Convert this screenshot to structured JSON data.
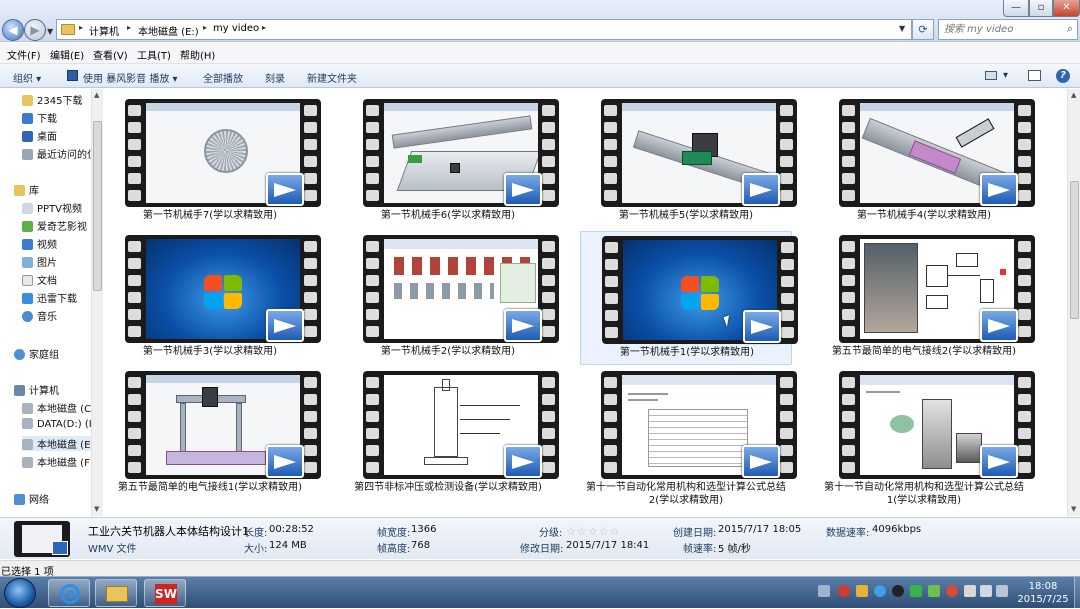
{
  "window": {
    "min": "—",
    "max": "▫",
    "close": "✕"
  },
  "address": {
    "crumbs": [
      "计算机",
      "本地磁盘 (E:)",
      "my video"
    ],
    "search_placeholder": "搜索 my video"
  },
  "menu": [
    "文件(F)",
    "编辑(E)",
    "查看(V)",
    "工具(T)",
    "帮助(H)"
  ],
  "toolbar": {
    "organize": "组织",
    "play_with": "使用 暴风影音 播放",
    "play_all": "全部播放",
    "burn": "刻录",
    "new_folder": "新建文件夹"
  },
  "nav": {
    "favorites": [
      "2345下载",
      "下载",
      "桌面",
      "最近访问的位"
    ],
    "library_title": "库",
    "libraries": [
      "PPTV视频",
      "爱奇艺影视",
      "视频",
      "图片",
      "文档",
      "迅雷下载",
      "音乐"
    ],
    "homegroup": "家庭组",
    "computer_title": "计算机",
    "drives": [
      "本地磁盘 (C",
      "DATA(D:) (I",
      "本地磁盘 (E",
      "本地磁盘 (F"
    ],
    "network": "网络"
  },
  "files": [
    {
      "name": "第一节机械手7(学以求精致用)",
      "thumb": "gear"
    },
    {
      "name": "第一节机械手6(学以求精致用)",
      "thumb": "rail"
    },
    {
      "name": "第一节机械手5(学以求精致用)",
      "thumb": "motor"
    },
    {
      "name": "第一节机械手4(学以求精致用)",
      "thumb": "plate"
    },
    {
      "name": "第一节机械手3(学以求精致用)",
      "thumb": "win7"
    },
    {
      "name": "第一节机械手2(学以求精致用)",
      "thumb": "icons"
    },
    {
      "name": "第一节机械手1(学以求精致用)",
      "thumb": "win7",
      "selected": true
    },
    {
      "name": "第五节最简单的电气接线2(学以求精致用)",
      "thumb": "circuit"
    },
    {
      "name": "第五节最简单的电气接线1(学以求精致用)",
      "thumb": "press"
    },
    {
      "name": "第四节非标冲压或检测设备(学以求精致用)",
      "thumb": "drawing"
    },
    {
      "name": "第十一节自动化常用机构和选型计算公式总结2(学以求精致用)",
      "thumb": "table"
    },
    {
      "name": "第十一节自动化常用机构和选型计算公式总结1(学以求精致用)",
      "thumb": "docphoto"
    }
  ],
  "details": {
    "filename": "工业六关节机器人本体结构设计1",
    "filetype": "WMV 文件",
    "length_label": "长度:",
    "length": "00:28:52",
    "size_label": "大小:",
    "size": "124 MB",
    "width_label": "帧宽度:",
    "width": "1366",
    "height_label": "帧高度:",
    "height": "768",
    "rating_label": "分级:",
    "rating": "☆☆☆☆☆",
    "modified_label": "修改日期:",
    "modified": "2015/7/17 18:41",
    "created_label": "创建日期:",
    "created": "2015/7/17 18:05",
    "fps_label": "帧速率:",
    "fps": "5 帧/秒",
    "datarate_label": "数据速率:",
    "datarate": "4096kbps"
  },
  "status": "已选择 1 项",
  "clock": {
    "time": "18:08",
    "date": "2015/7/25"
  },
  "colors": {
    "accent": "#2f66b3",
    "selection": "#eaf3fd"
  }
}
